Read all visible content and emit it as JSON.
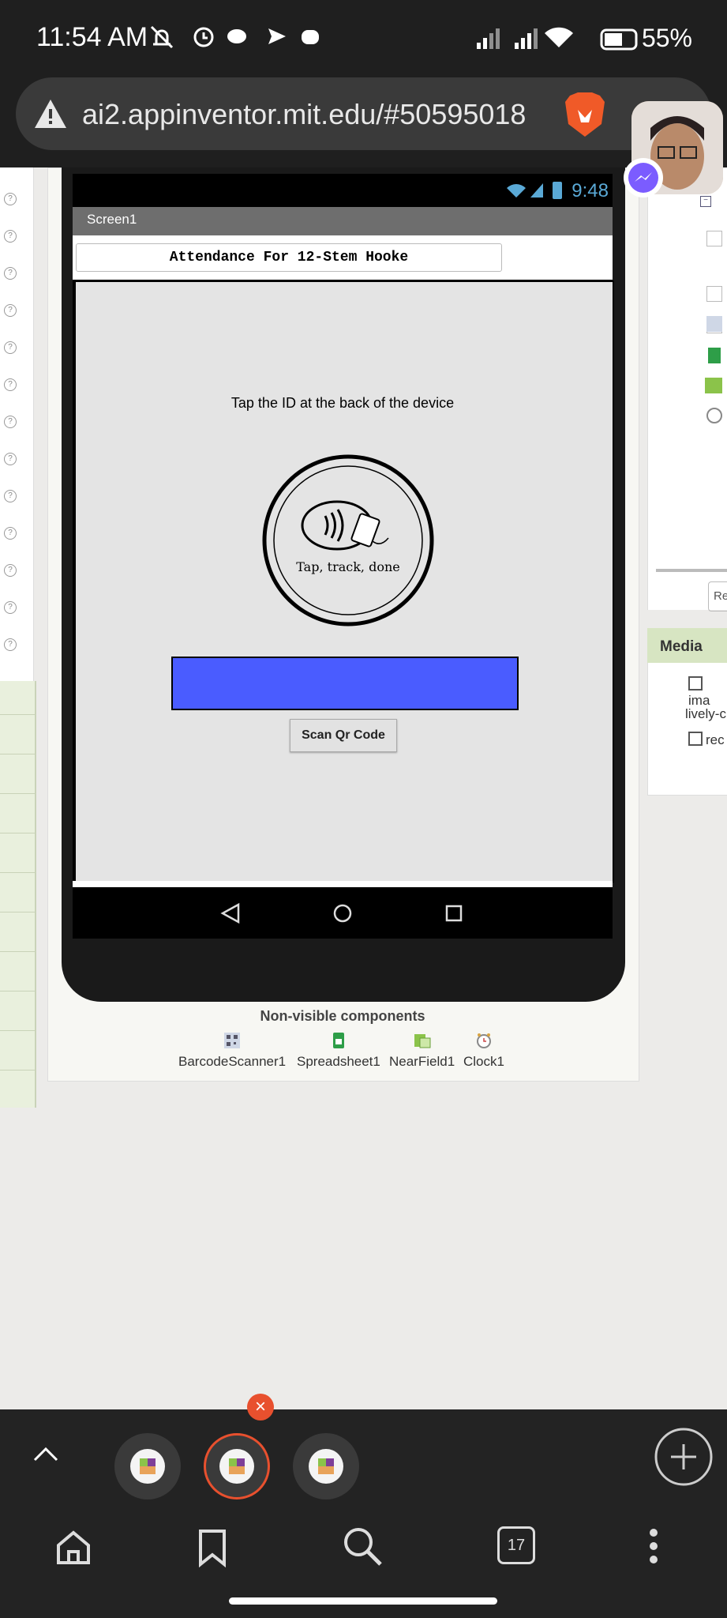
{
  "status_bar": {
    "time": "11:54 AM",
    "battery": "55%"
  },
  "browser": {
    "url": "ai2.appinventor.mit.edu/#50595018"
  },
  "designer": {
    "phone_time": "9:48",
    "screen_name": "Screen1",
    "attendance_title": "Attendance For 12-Stem Hooke",
    "tap_instruction": "Tap the ID at the back of the device",
    "logo_text": "Tap, track, done",
    "scan_button": "Scan Qr Code",
    "blue_bar_color": "#4a5cff"
  },
  "non_visible": {
    "title": "Non-visible components",
    "items": [
      {
        "label": "BarcodeScanner1",
        "icon": "barcode-icon"
      },
      {
        "label": "Spreadsheet1",
        "icon": "spreadsheet-icon"
      },
      {
        "label": "NearField1",
        "icon": "nearfield-icon"
      },
      {
        "label": "Clock1",
        "icon": "clock-icon"
      }
    ]
  },
  "right_panel": {
    "media_title": "Media",
    "media_items": [
      "ima",
      "lively-c",
      "rec"
    ],
    "button_partial": "Re"
  },
  "tabs": {
    "count": "17"
  },
  "colors": {
    "accent": "#e8502e"
  }
}
